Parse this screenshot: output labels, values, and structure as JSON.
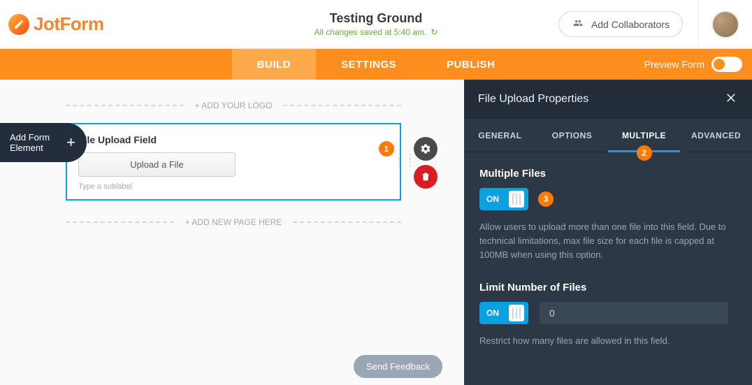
{
  "header": {
    "brand": "JotForm",
    "title": "Testing Ground",
    "saved_text": "All changes saved at 5:40 am.",
    "collab_label": "Add Collaborators"
  },
  "tabs": {
    "build": "BUILD",
    "settings": "SETTINGS",
    "publish": "PUBLISH",
    "preview_label": "Preview Form"
  },
  "sidebar": {
    "add_element_line1": "Add Form",
    "add_element_line2": "Element"
  },
  "canvas": {
    "add_logo": "+ ADD YOUR LOGO",
    "add_page": "+ ADD NEW PAGE HERE",
    "field_title": "File Upload Field",
    "upload_button": "Upload a File",
    "sublabel_placeholder": "Type a sublabel"
  },
  "annotations": {
    "a1": "1",
    "a2": "2",
    "a3": "3"
  },
  "feedback": {
    "label": "Send Feedback"
  },
  "panel": {
    "title": "File Upload Properties",
    "tabs": {
      "general": "GENERAL",
      "options": "OPTIONS",
      "multiple": "MULTIPLE",
      "advanced": "ADVANCED"
    },
    "multiple": {
      "title": "Multiple Files",
      "toggle": "ON",
      "desc": "Allow users to upload more than one file into this field. Due to technical limitations, max file size for each file is capped at 100MB when using this option."
    },
    "limit": {
      "title": "Limit Number of Files",
      "toggle": "ON",
      "value": "0",
      "desc": "Restrict how many files are allowed in this field."
    }
  }
}
